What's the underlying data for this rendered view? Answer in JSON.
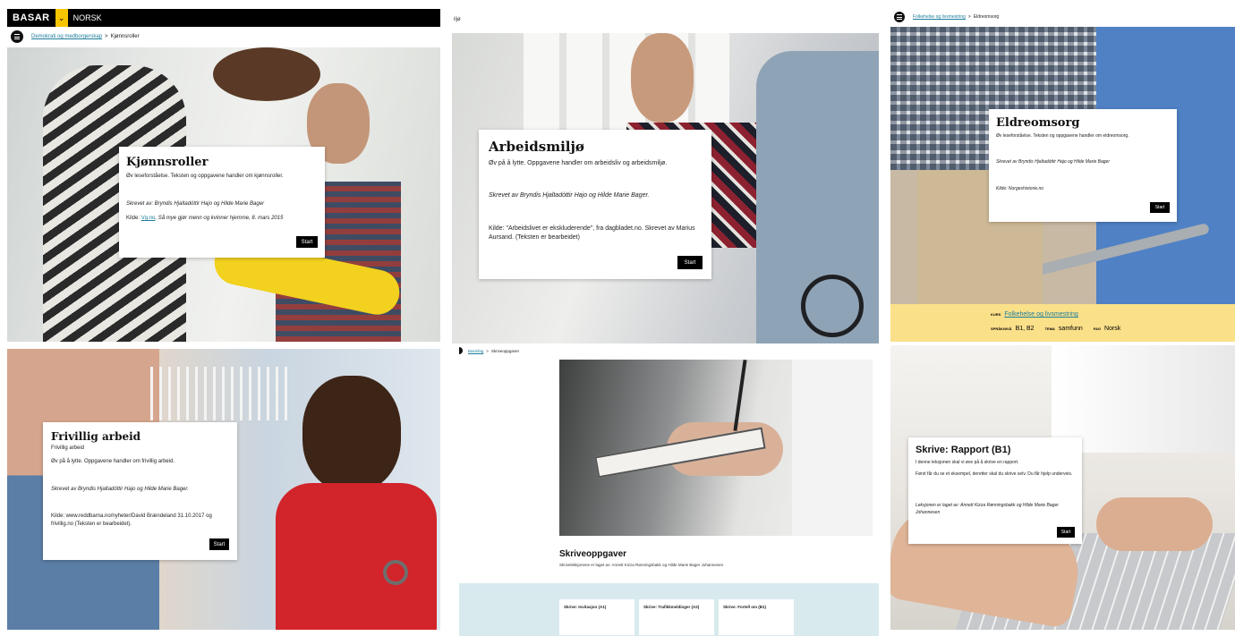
{
  "p1": {
    "logo": "BASAR",
    "chevron": "⌄",
    "lang": "NORSK",
    "crumb_link": "Demokrati og medborgerskap",
    "crumb_sep": ">",
    "crumb_current": "Kjønnsroller",
    "title": "Kjønnsroller",
    "desc": "Øv leseforståelse. Teksten og oppgavene handler om kjønnsroller.",
    "author": "Skrevet av: Bryndis Hjaltadóttir Hajo og Hilde Marie Bager",
    "source_prefix": "Kilde: ",
    "source_link": "Vg.no",
    "source_rest": ", Så mye gjør menn og kvinner hjemme, 8. mars 2015",
    "start": "Start"
  },
  "p2": {
    "top_label": "iljø",
    "title": "Arbeidsmiljø",
    "desc": "Øv på å lytte. Oppgavene handler om arbeidsliv og arbeidsmiljø.",
    "author": "Skrevet av Bryndis Hjaltadóttir Hajo og Hilde Marie Bager.",
    "source": "Kilde: \"Arbeidslivet er ekskluderende\", fra dagbladet.no. Skrevet av Marius Aursand. (Teksten er bearbeidet)",
    "start": "Start"
  },
  "p3": {
    "crumb_link": "Folkehelse og livsmestring",
    "crumb_sep": ">",
    "crumb_current": "Eldreomsorg",
    "title": "Eldreomsorg",
    "desc": "Øv leseforståelse. Teksten og oppgavene handler om eldreomsorg.",
    "author": "Skrevet av Bryndis Hjaltadóttir Hajo og Hilde Marie Bager",
    "source": "Kilde: Norgeshistorie.no",
    "start": "Start",
    "meta_kurs_label": "KURS",
    "meta_kurs_value": "Folkehelse og livsmestring",
    "meta_niva_label": "SPRÅKNIVÅ",
    "meta_niva_value": "B1, B2",
    "meta_tema_label": "TEMA",
    "meta_tema_value": "samfunn",
    "meta_fag_label": "FAG",
    "meta_fag_value": "Norsk",
    "banner_color": "#fbe08a"
  },
  "p4": {
    "title": "Frivillig arbeid",
    "subtitle": "Frivillig arbeid",
    "desc": "Øv på å lytte. Oppgavene handler om frivillig arbeid.",
    "author": "Skrevet av Bryndis Hjaltadóttir Hajo og Hilde Marie Bager.",
    "source": "Kilde: www.reddbarna.no/nyheter/David Brændeland 31.10.2017 og frivillig.no (Teksten er bearbeidet).",
    "start": "Start"
  },
  "p5": {
    "crumb_link": "Basisfag",
    "crumb_sep": ">",
    "crumb_current": "Skriveoppgaver",
    "title": "Skriveoppgaver",
    "desc": "Skrivelekkjonene er laget av: Annett Kizza Rønningsbakk og Hilde Marie Bager Johannesen",
    "tiles": [
      "Skrive: Invitasjon (A1)",
      "Skrive: Trafikkmeldinger (A2)",
      "Skrive: Fortell om (B1)"
    ],
    "band_color": "#d8eaee"
  },
  "p6": {
    "title": "Skrive: Rapport (B1)",
    "intro": "I denne leksjonen skal vi øve på å skrive en rapport.",
    "desc": "Først får du se et eksempel, deretter skal du skrive selv. Du får hjelp underveis.",
    "author": "Leksjonen er laget av: Annett Kizza Rønningsbakk og Hilde Marie Bager Johannesen",
    "start": "Start"
  }
}
